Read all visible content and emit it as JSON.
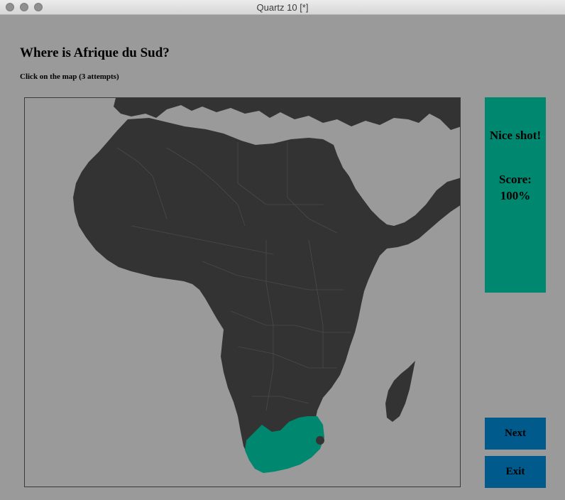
{
  "window": {
    "title": "Quartz 10 [*]"
  },
  "quiz": {
    "question": "Where is Afrique du Sud?",
    "instruction": "Click on the map (3 attempts)"
  },
  "feedback": {
    "message": "Nice shot!",
    "score_label": "Score:",
    "score_value": "100%"
  },
  "buttons": {
    "next": "Next",
    "exit": "Exit"
  },
  "colors": {
    "background": "#9a9a9a",
    "land": "#333333",
    "highlight": "#00876f",
    "button": "#005a8c"
  }
}
